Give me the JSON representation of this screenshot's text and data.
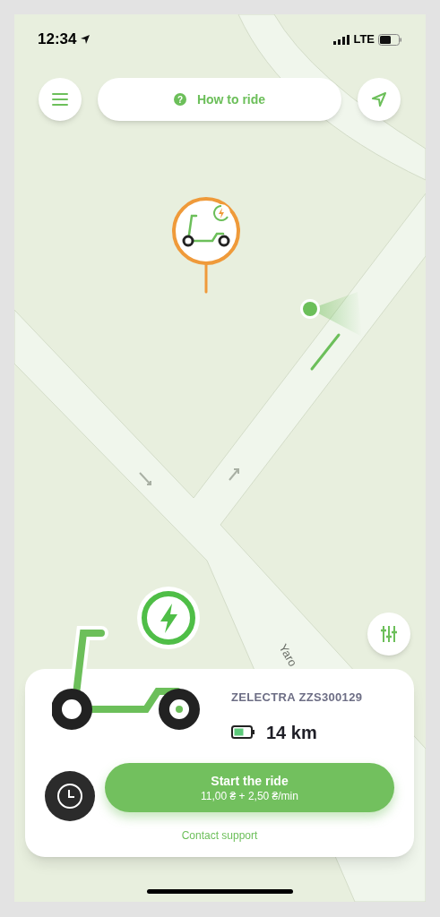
{
  "status_bar": {
    "time": "12:34",
    "network": "LTE"
  },
  "top_bar": {
    "help_glyph": "?",
    "help_label": "How to ride"
  },
  "map": {
    "street_label": "Yaro",
    "vehicle_pin": {
      "charging": true
    }
  },
  "vehicle_card": {
    "name": "ZELECTRA ZZS300129",
    "range": "14 km",
    "charging": true,
    "start_button": {
      "label": "Start the ride",
      "price": "11,00 ₴ + 2,50 ₴/min"
    },
    "support_link": "Contact support"
  }
}
